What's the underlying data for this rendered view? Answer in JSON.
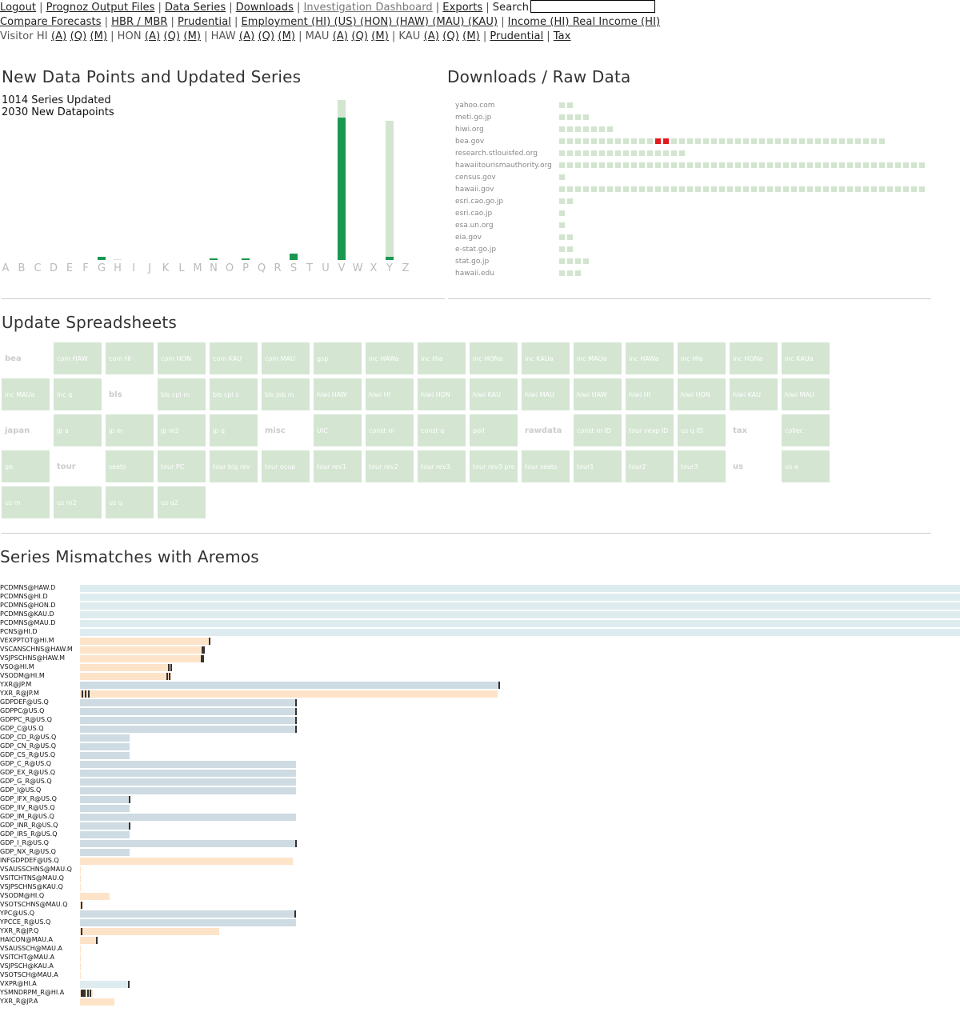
{
  "nav": {
    "row1": [
      {
        "label": "Logout",
        "link": true
      },
      {
        "label": "Prognoz Output Files",
        "link": true
      },
      {
        "label": "Data Series",
        "link": true
      },
      {
        "label": "Downloads",
        "link": true
      },
      {
        "label": "Investigation Dashboard",
        "link": true,
        "grey": true
      },
      {
        "label": "Exports",
        "link": true
      }
    ],
    "search_label": "Search",
    "row2": [
      "Compare Forecasts",
      "HBR / MBR",
      "Prudential",
      "Employment (HI) (US) (HON) (HAW) (MAU) (KAU)",
      "Income (HI) Real Income (HI)"
    ],
    "row3": [
      {
        "prefix": "Visitor HI",
        "links": [
          "(A)",
          "(Q)",
          "(M)"
        ]
      },
      {
        "prefix": "HON",
        "links": [
          "(A)",
          "(Q)",
          "(M)"
        ]
      },
      {
        "prefix": "HAW",
        "links": [
          "(A)",
          "(Q)",
          "(M)"
        ]
      },
      {
        "prefix": "MAU",
        "links": [
          "(A)",
          "(Q)",
          "(M)"
        ]
      },
      {
        "prefix": "KAU",
        "links": [
          "(A)",
          "(Q)",
          "(M)"
        ]
      },
      {
        "prefix": "",
        "links": [
          "Prudential"
        ]
      },
      {
        "prefix": "",
        "links": [
          "Tax"
        ]
      }
    ]
  },
  "new_data": {
    "title": "New Data Points and Updated Series",
    "series_updated": "1014 Series Updated",
    "new_datapoints": "2030 New Datapoints",
    "chart_data": {
      "type": "bar",
      "categories": [
        "A",
        "B",
        "C",
        "D",
        "E",
        "F",
        "G",
        "H",
        "I",
        "J",
        "K",
        "L",
        "M",
        "N",
        "O",
        "P",
        "Q",
        "R",
        "S",
        "T",
        "U",
        "V",
        "W",
        "X",
        "Y",
        "Z"
      ],
      "series": [
        {
          "values": [
            0,
            0,
            0,
            0,
            0,
            0,
            4,
            0,
            0,
            0,
            0,
            0,
            0,
            2,
            0,
            2,
            0,
            0,
            8,
            0,
            0,
            178,
            0,
            0,
            4,
            0
          ]
        },
        {
          "values": [
            0,
            0,
            0,
            0,
            0,
            0,
            4,
            1,
            0,
            0,
            0,
            0,
            0,
            2,
            0,
            2,
            0,
            0,
            8,
            0,
            0,
            200,
            0,
            0,
            174,
            0
          ]
        }
      ],
      "colors": {
        "new": "#1a9850",
        "updated": "#d3e5d0"
      }
    }
  },
  "downloads": {
    "title": "Downloads / Raw Data",
    "chart_data": {
      "type": "table",
      "rows": [
        {
          "host": "yahoo.com",
          "count": 2,
          "errors": []
        },
        {
          "host": "meti.go.jp",
          "count": 4,
          "errors": []
        },
        {
          "host": "hiwi.org",
          "count": 7,
          "errors": []
        },
        {
          "host": "bea.gov",
          "count": 41,
          "errors": [
            12,
            13
          ]
        },
        {
          "host": "research.stlouisfed.org",
          "count": 16,
          "errors": []
        },
        {
          "host": "hawaiitourismauthority.org",
          "count": 46,
          "errors": []
        },
        {
          "host": "census.gov",
          "count": 1,
          "errors": []
        },
        {
          "host": "hawaii.gov",
          "count": 46,
          "errors": []
        },
        {
          "host": "esri.cao.go.jp",
          "count": 2,
          "errors": []
        },
        {
          "host": "esri.cao.jp",
          "count": 1,
          "errors": []
        },
        {
          "host": "esa.un.org",
          "count": 1,
          "errors": []
        },
        {
          "host": "eia.gov",
          "count": 2,
          "errors": []
        },
        {
          "host": "e-stat.go.jp",
          "count": 2,
          "errors": []
        },
        {
          "host": "stat.go.jp",
          "count": 4,
          "errors": []
        },
        {
          "host": "hawaii.edu",
          "count": 3,
          "errors": []
        }
      ],
      "colors": {
        "ok": "#d3e5d0",
        "error": "#e41a1c"
      }
    }
  },
  "spreadsheets": {
    "title": "Update Spreadsheets",
    "tiles": [
      {
        "t": "bea",
        "g": true
      },
      "com HAW",
      "com HI",
      "com HON",
      "com KAU",
      "com MAU",
      "gsp",
      "inc HAWa",
      "inc HIa",
      "inc HONa",
      "inc KAUa",
      "inc MAUa",
      "inc HAWa",
      "inc HIa",
      "inc HONa",
      "inc KAUa",
      "inc MAUa",
      "inc q",
      {
        "t": "bls",
        "g": true
      },
      "bls cpi m",
      "bls cpi s",
      "bls job m",
      "hiwi HAW",
      "hiwi HI",
      "hiwi HON",
      "hiwi KAU",
      "hiwi MAU",
      "hiwi HAW",
      "hiwi HI",
      "hiwi HON",
      "hiwi KAU",
      "hiwi MAU",
      {
        "t": "japan",
        "g": true
      },
      "jp a",
      "jp m",
      "jp m2",
      "jp q",
      {
        "t": "misc",
        "g": true
      },
      "UIC",
      "const m",
      "const q",
      "poll",
      {
        "t": "rawdata",
        "g": true
      },
      "const m ID",
      "tour vexp ID",
      "us q ID",
      {
        "t": "tax",
        "g": true
      },
      "collec",
      "ge",
      {
        "t": "tour",
        "g": true
      },
      "seats",
      "tour PC",
      "tour big rev",
      "tour ocup",
      "tour rev1",
      "tour rev2",
      "tour rev3",
      "tour rev3 pre",
      "tour seats",
      "tour1",
      "tour2",
      "tour3",
      {
        "t": "us",
        "g": true
      },
      "us a",
      "us m",
      "us m2",
      "us q",
      "us q2"
    ]
  },
  "mismatches": {
    "title": "Series Mismatches with Aremos",
    "chart_data": {
      "type": "bar",
      "rows": [
        {
          "name": "PCDMNS@HAW.D",
          "value": 1100,
          "kind": "blue"
        },
        {
          "name": "PCDMNS@HI.D",
          "value": 1100,
          "kind": "blue"
        },
        {
          "name": "PCDMNS@HON.D",
          "value": 1100,
          "kind": "blue"
        },
        {
          "name": "PCDMNS@KAU.D",
          "value": 1100,
          "kind": "blue"
        },
        {
          "name": "PCDMNS@MAU.D",
          "value": 1100,
          "kind": "blue"
        },
        {
          "name": "PCNS@HI.D",
          "value": 1100,
          "kind": "blue"
        },
        {
          "name": "VEXPPTOT@HI.M",
          "value": 162,
          "kind": "orange",
          "marks": [
            161
          ]
        },
        {
          "name": "VSCANSCHNS@HAW.M",
          "value": 156,
          "kind": "orange",
          "marks": [
            152,
            154
          ]
        },
        {
          "name": "VSJPSCHNS@HAW.M",
          "value": 155,
          "kind": "orange",
          "marks": [
            151,
            153
          ]
        },
        {
          "name": "VSO@HI.M",
          "value": 114,
          "kind": "orange",
          "marks": [
            110,
            113
          ]
        },
        {
          "name": "VSODM@HI.M",
          "value": 114,
          "kind": "orange",
          "marks": [
            108,
            111
          ]
        },
        {
          "name": "YXR@JP.M",
          "value": 524,
          "kind": "grey",
          "marks": [
            523
          ]
        },
        {
          "name": "YXR_R@JP.M",
          "value": 522,
          "kind": "orange",
          "marks": [
            2,
            6,
            10
          ]
        },
        {
          "name": "GDPDEF@US.Q",
          "value": 270,
          "kind": "grey",
          "marks": [
            269
          ]
        },
        {
          "name": "GDPPC@US.Q",
          "value": 270,
          "kind": "grey",
          "marks": [
            269
          ]
        },
        {
          "name": "GDPPC_R@US.Q",
          "value": 270,
          "kind": "grey",
          "marks": [
            269
          ]
        },
        {
          "name": "GDP_C@US.Q",
          "value": 270,
          "kind": "grey",
          "marks": [
            269
          ]
        },
        {
          "name": "GDP_CD_R@US.Q",
          "value": 62,
          "kind": "grey"
        },
        {
          "name": "GDP_CN_R@US.Q",
          "value": 62,
          "kind": "grey"
        },
        {
          "name": "GDP_CS_R@US.Q",
          "value": 62,
          "kind": "grey"
        },
        {
          "name": "GDP_C_R@US.Q",
          "value": 270,
          "kind": "grey"
        },
        {
          "name": "GDP_EX_R@US.Q",
          "value": 270,
          "kind": "grey"
        },
        {
          "name": "GDP_G_R@US.Q",
          "value": 270,
          "kind": "grey"
        },
        {
          "name": "GDP_I@US.Q",
          "value": 270,
          "kind": "grey"
        },
        {
          "name": "GDP_IFX_R@US.Q",
          "value": 62,
          "kind": "grey",
          "marks": [
            61
          ]
        },
        {
          "name": "GDP_IIV_R@US.Q",
          "value": 62,
          "kind": "grey"
        },
        {
          "name": "GDP_IM_R@US.Q",
          "value": 270,
          "kind": "grey"
        },
        {
          "name": "GDP_INR_R@US.Q",
          "value": 62,
          "kind": "grey",
          "marks": [
            61
          ]
        },
        {
          "name": "GDP_IRS_R@US.Q",
          "value": 62,
          "kind": "grey"
        },
        {
          "name": "GDP_I_R@US.Q",
          "value": 270,
          "kind": "grey",
          "marks": [
            269
          ]
        },
        {
          "name": "GDP_NX_R@US.Q",
          "value": 62,
          "kind": "grey"
        },
        {
          "name": "INFGDPDEF@US.Q",
          "value": 266,
          "kind": "orange"
        },
        {
          "name": "VSAUSSCHNS@MAU.Q",
          "value": 1,
          "kind": "orange"
        },
        {
          "name": "VSITCHTNS@MAU.Q",
          "value": 1,
          "kind": "orange"
        },
        {
          "name": "VSJPSCHNS@KAU.Q",
          "value": 1,
          "kind": "orange"
        },
        {
          "name": "VSODM@HI.Q",
          "value": 37,
          "kind": "orange"
        },
        {
          "name": "VSOTSCHNS@MAU.Q",
          "value": 3,
          "kind": "orange",
          "marks": [
            1
          ]
        },
        {
          "name": "YPC@US.Q",
          "value": 270,
          "kind": "grey",
          "marks": [
            268
          ]
        },
        {
          "name": "YPCCE_R@US.Q",
          "value": 270,
          "kind": "grey"
        },
        {
          "name": "YXR_R@JP.Q",
          "value": 174,
          "kind": "orange",
          "marks": [
            1
          ]
        },
        {
          "name": "HAICON@MAU.A",
          "value": 21,
          "kind": "orange",
          "marks": [
            20
          ]
        },
        {
          "name": "VSAUSSCH@MAU.A",
          "value": 1,
          "kind": "orange"
        },
        {
          "name": "VSITCHT@MAU.A",
          "value": 1,
          "kind": "orange"
        },
        {
          "name": "VSJPSCH@KAU.A",
          "value": 1,
          "kind": "orange"
        },
        {
          "name": "VSOTSCH@MAU.A",
          "value": 1,
          "kind": "orange"
        },
        {
          "name": "VXPR@HI.A",
          "value": 61,
          "kind": "blue",
          "marks": [
            60
          ]
        },
        {
          "name": "YSMNDRPM_R@HI.A",
          "value": 16,
          "kind": "orange",
          "marks": [
            1,
            3,
            5,
            9,
            12
          ]
        },
        {
          "name": "YXR_R@JP.A",
          "value": 43,
          "kind": "orange"
        }
      ],
      "colors": {
        "blue": "#deecf0",
        "orange": "#fde3c8",
        "grey": "#cfdbe2",
        "mark": "#333333"
      }
    }
  }
}
